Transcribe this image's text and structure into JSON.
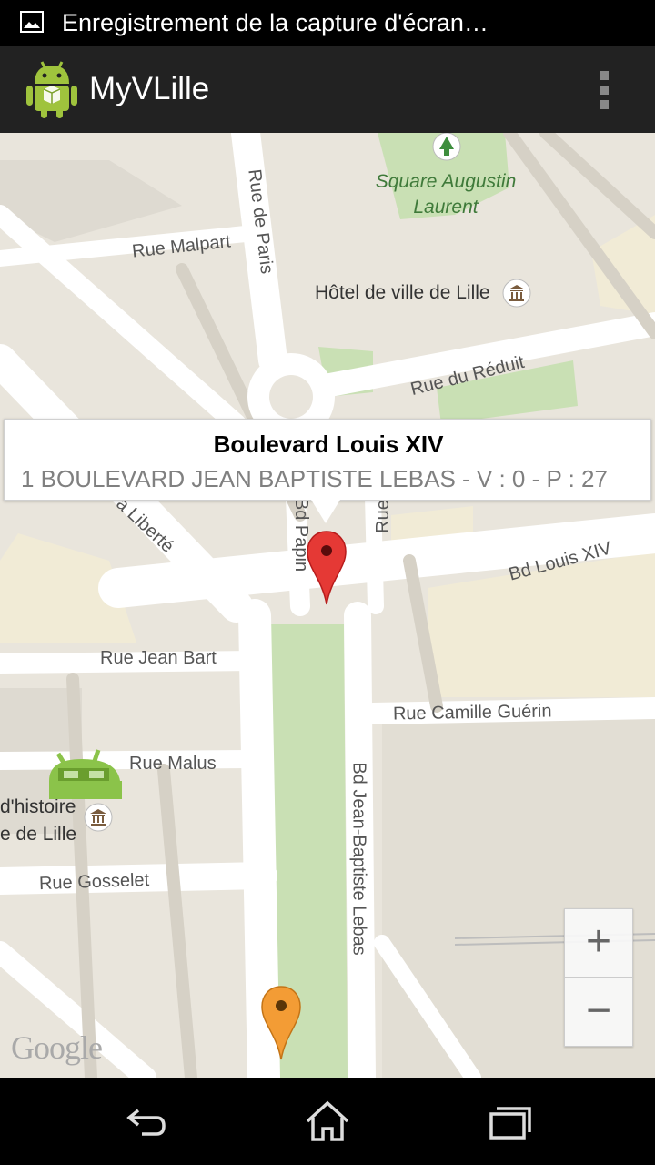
{
  "status_bar": {
    "notification_icon": "image-icon",
    "text": "Enregistrement de la capture d'écran…"
  },
  "action_bar": {
    "app_icon": "android-icon",
    "title": "MyVLille",
    "overflow_icon": "overflow-menu-icon"
  },
  "map": {
    "streets": {
      "rue_de_paris": "Rue de Paris",
      "rue_malpart": "Rue Malpart",
      "rue_du_reduit": "Rue du Réduit",
      "rue_liberte": "a Liberté",
      "bd_papin": "Bd Papin",
      "rue_partial": "Rue",
      "bd_louis_xiv": "Bd Louis XIV",
      "rue_jean_bart": "Rue Jean Bart",
      "rue_camille_guerin": "Rue Camille Guérin",
      "rue_malus": "Rue Malus",
      "rue_gosselet": "Rue Gosselet",
      "bd_jean_baptiste_lebas": "Bd Jean-Baptiste Lebas"
    },
    "pois": {
      "square_line1": "Square Augustin",
      "square_line2": "Laurent",
      "hotel_de_ville": "Hôtel de ville de Lille",
      "museum_line1": "d'histoire",
      "museum_line2": "e de Lille"
    },
    "info_window": {
      "title": "Boulevard Louis XIV",
      "snippet": "1 BOULEVARD JEAN BAPTISTE LEBAS  - V : 0 - P : 27"
    },
    "markers": [
      {
        "name": "selected-station",
        "color": "#e53935"
      },
      {
        "name": "station",
        "color": "#f39c35"
      }
    ],
    "zoom": {
      "in_label": "+",
      "out_label": "−"
    },
    "attribution": "Google"
  },
  "nav_bar": {
    "back_icon": "back-icon",
    "home_icon": "home-icon",
    "recents_icon": "recents-icon"
  },
  "colors": {
    "action_bar": "#222222",
    "map_land": "#e9e5dc",
    "road": "#ffffff",
    "park": "#c9e0b4",
    "block": "#f1ebd6"
  }
}
